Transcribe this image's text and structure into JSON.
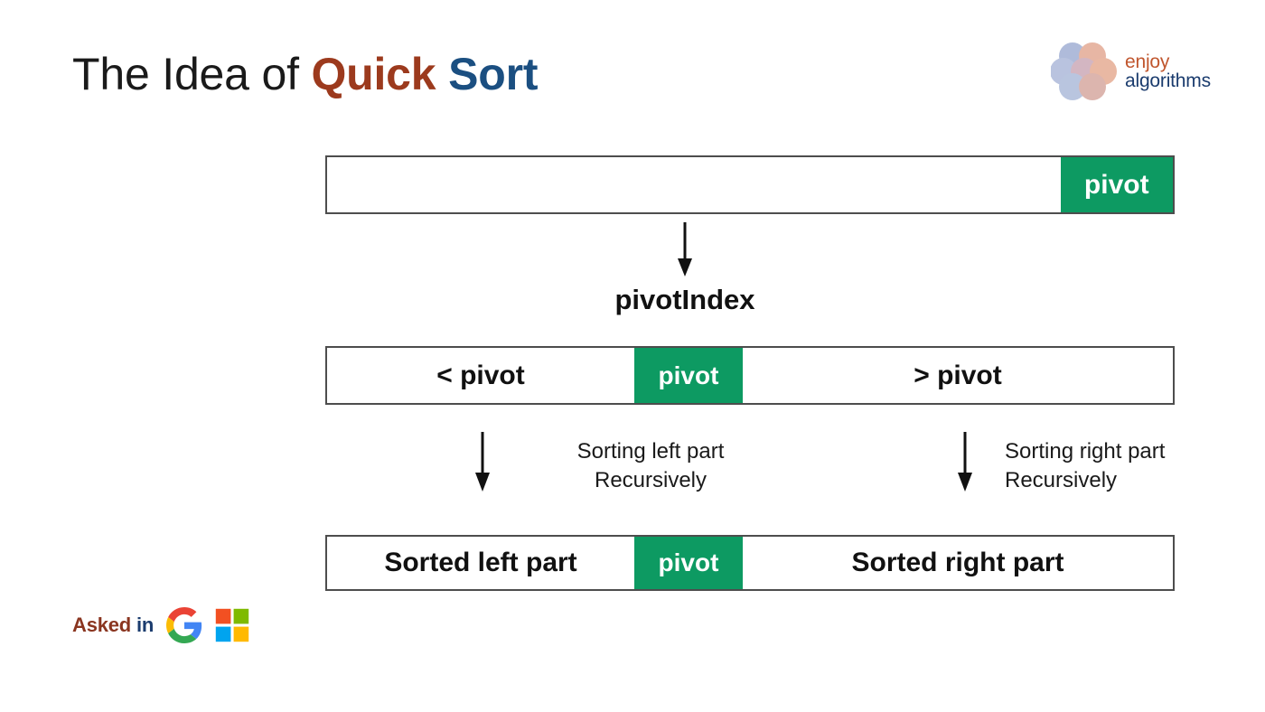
{
  "title": {
    "part_plain": "The Idea of ",
    "part_quick": "Quick",
    "space": " ",
    "part_sort": "Sort"
  },
  "brand": {
    "line1": "enjoy",
    "line2": "algorithms",
    "mark_icon": "flower-circles-logo",
    "color_line1": "#c0562e",
    "color_line2": "#1b3c6e"
  },
  "diagram": {
    "accent_green": "#0d9a62",
    "border_color": "#4d4d4d",
    "bars": [
      {
        "name": "initial-array",
        "segments": [
          {
            "label": "",
            "type": "empty"
          },
          {
            "label": "pivot",
            "type": "pivot"
          }
        ]
      },
      {
        "name": "partitioned-array",
        "segments": [
          {
            "label": "< pivot",
            "type": "left"
          },
          {
            "label": "pivot",
            "type": "pivot"
          },
          {
            "label": "> pivot",
            "type": "right"
          }
        ]
      },
      {
        "name": "sorted-array",
        "segments": [
          {
            "label": "Sorted left part",
            "type": "left"
          },
          {
            "label": "pivot",
            "type": "pivot"
          },
          {
            "label": "Sorted right part",
            "type": "right"
          }
        ]
      }
    ],
    "pivot_index_label": "pivotIndex",
    "left_recursion_line1": "Sorting left part",
    "left_recursion_line2": "Recursively",
    "right_recursion_line1": "Sorting right part",
    "right_recursion_line2": "Recursively",
    "arrow_icon": "down-arrow-icon"
  },
  "footer": {
    "asked_word": "Asked",
    "asked_prep": " in",
    "companies": [
      {
        "name": "google-logo",
        "label": "Google"
      },
      {
        "name": "microsoft-logo",
        "label": "Microsoft"
      }
    ]
  }
}
